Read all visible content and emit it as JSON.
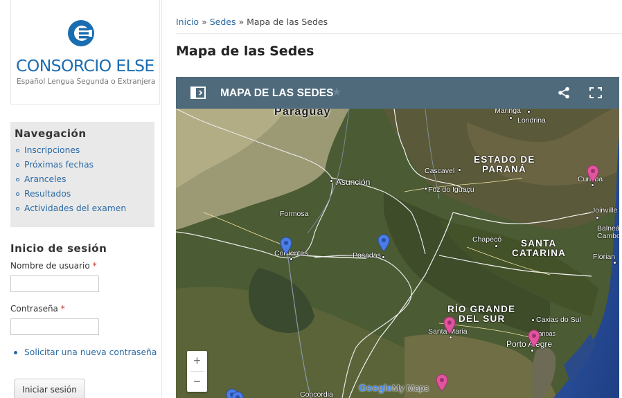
{
  "site": {
    "logo_name": "CONSORCIO ELSE",
    "logo_tagline": "Español Lengua Segunda o Extranjera"
  },
  "navigation": {
    "title": "Navegación",
    "items": [
      {
        "label": "Inscripciones"
      },
      {
        "label": "Próximas fechas"
      },
      {
        "label": "Aranceles"
      },
      {
        "label": "Resultados"
      },
      {
        "label": "Actividades del examen"
      }
    ]
  },
  "login": {
    "title": "Inicio de sesión",
    "username_label": "Nombre de usuario",
    "password_label": "Contraseña",
    "required_mark": "*",
    "username_value": "",
    "password_value": "",
    "reset_link": "Solicitar una nueva contraseña",
    "submit_label": "Iniciar sesión"
  },
  "breadcrumb": {
    "items": [
      "Inicio",
      "Sedes",
      "Mapa de las Sedes"
    ],
    "separator": "»"
  },
  "page": {
    "title": "Mapa de las Sedes"
  },
  "map": {
    "header_title": "MAPA DE LAS SEDES",
    "star_icon": "star-icon",
    "icons": [
      "sidebar-toggle-icon",
      "share-icon",
      "fullscreen-icon"
    ],
    "zoom_in": "+",
    "zoom_out": "−",
    "attribution": {
      "google": "Google",
      "product": "My Maps"
    },
    "colors": {
      "header": "#4f6a7b",
      "pin_blue": "#4a7de8",
      "pin_pink": "#e0559e"
    },
    "labels": {
      "country": "Paraguay",
      "states": [
        "ESTADO DE",
        "PARANÁ",
        "SANTA",
        "CATARINA",
        "RÍO GRANDE",
        "DEL SUR"
      ],
      "cities": [
        "Maringa",
        "Londrina",
        "Cascavel",
        "Asunción",
        "Foz do Iguaçu",
        "Curitiba",
        "Formosa",
        "Joinville",
        "Balneá",
        "Cambo",
        "Chapecó",
        "Corrientes",
        "Posadas",
        "Florian",
        "Caxias do Sul",
        "Santa Maria",
        "Canoas",
        "Porto Alegre",
        "Concordia"
      ]
    }
  }
}
